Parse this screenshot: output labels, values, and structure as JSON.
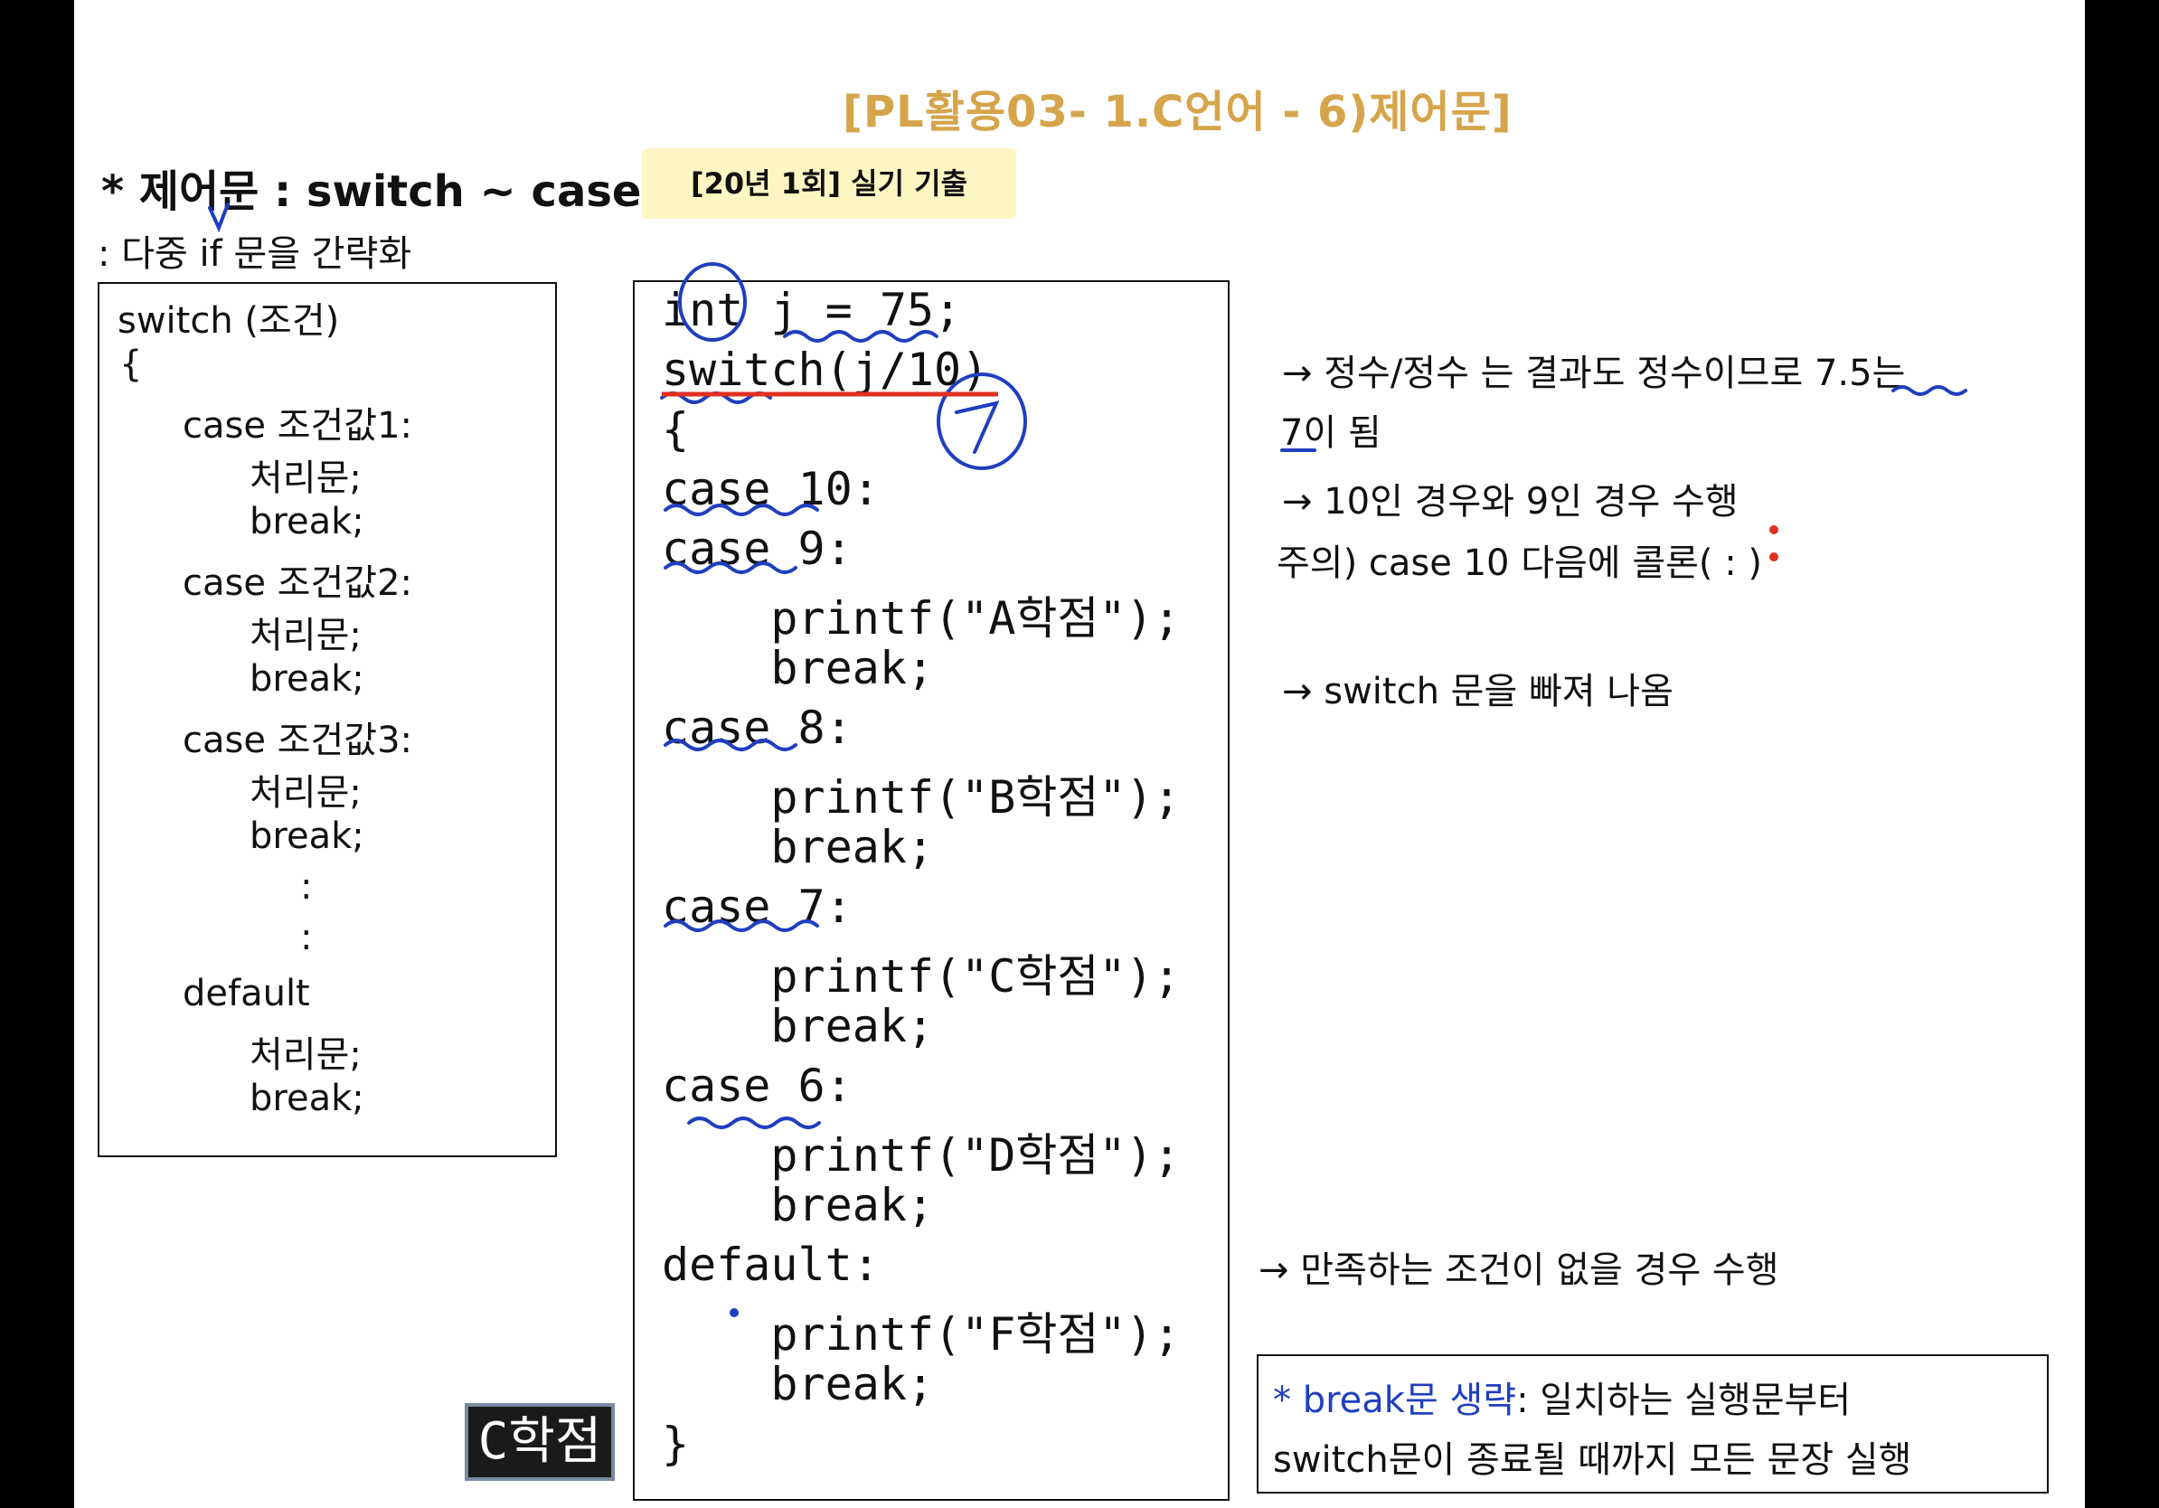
{
  "slide": {
    "title": "[PL활용03- 1.C언어 - 6)제어문]",
    "heading": "* 제어문 : switch ~ case 문",
    "badge": "[20년 1회] 실기 기출",
    "subtitle": ": 다중 if 문을 간략화"
  },
  "syntax_lines": [
    "switch (조건)",
    "{",
    "case 조건값1:",
    "처리문;",
    "break;",
    "case 조건값2:",
    "처리문;",
    "break;",
    "case 조건값3:",
    "처리문;",
    "break;",
    ":",
    ":",
    "default",
    "처리문;",
    "break;"
  ],
  "code_lines": [
    "int j = 75;",
    "switch(j/10)",
    "{",
    "case 10:",
    "case 9:",
    "    printf(\"A학점\");",
    "    break;",
    "case 8:",
    "    printf(\"B학점\");",
    "    break;",
    "case 7:",
    "    printf(\"C학점\");",
    "    break;",
    "case 6:",
    "    printf(\"D학점\");",
    "    break;",
    "default:",
    "    printf(\"F학점\");",
    "    break;",
    "}"
  ],
  "notes": {
    "note1_line1": "→ 정수/정수 는 결과도 정수이므로 7.5는",
    "note1_line2": "7이 됨",
    "note2_line1": "→ 10인 경우와 9인 경우 수행",
    "note2_line2": "주의) case 10 다음에 콜론( : )",
    "note3": "→ switch 문을 빠져 나옴",
    "note4": "→ 만족하는 조건이 없을 경우 수행"
  },
  "summary": {
    "prefix": "* break문 생략",
    "line1_rest": ": 일치하는 실행문부터",
    "line2": "switch문이 종료될 때까지 모든 문장 실행"
  },
  "thumbnail": {
    "label": "C학점"
  },
  "colors": {
    "title": "#d6a44a",
    "ink_blue": "#1f3fbf",
    "ink_red": "#e03020",
    "badge_bg": "#fdf6c3"
  }
}
